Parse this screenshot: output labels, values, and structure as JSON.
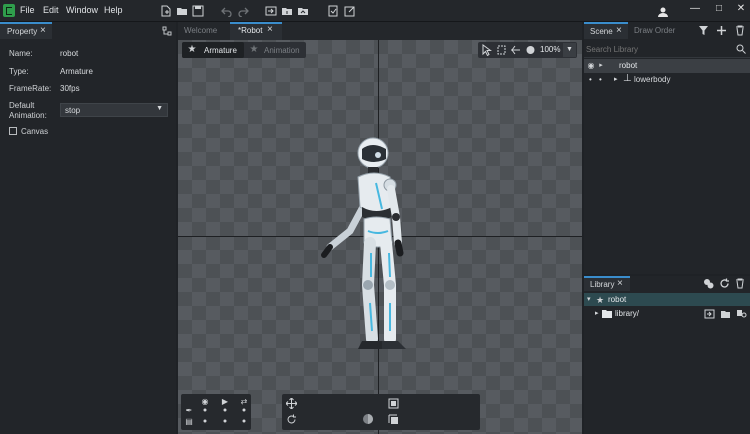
{
  "menu": {
    "items": [
      "File",
      "Edit",
      "Window",
      "Help"
    ]
  },
  "property_panel": {
    "tab_label": "Property",
    "fields": [
      {
        "label": "Name:",
        "value": "robot"
      },
      {
        "label": "Type:",
        "value": "Armature"
      },
      {
        "label": "FrameRate:",
        "value": "30fps"
      }
    ],
    "default_animation_label_1": "Default",
    "default_animation_label_2": "Animation:",
    "default_animation_value": "stop",
    "canvas_label": "Canvas"
  },
  "doc_tabs": [
    {
      "label": "Welcome"
    },
    {
      "label": "*Robot"
    }
  ],
  "mode_tabs": {
    "armature": "Armature",
    "animation": "Animation"
  },
  "zoom": "100%",
  "scene_panel": {
    "tabs": [
      "Scene",
      "Draw Order"
    ],
    "search_placeholder": "Search Library",
    "tree": [
      {
        "label": "robot"
      },
      {
        "label": "lowerbody"
      }
    ]
  },
  "library_panel": {
    "tab_label": "Library",
    "tree": [
      {
        "label": "robot"
      },
      {
        "label": "library/"
      }
    ]
  },
  "colors": {
    "accent": "#3a8dcc",
    "selection": "#2d4a50",
    "brand": "#2f9e4c"
  },
  "icons": [
    "app-logo-icon",
    "new-file-icon",
    "open-folder-icon",
    "save-icon",
    "undo-icon",
    "redo-icon",
    "import-icon",
    "export-icon",
    "folder-export-icon",
    "publish-icon",
    "edit-icon",
    "user-icon",
    "minimize-icon",
    "maximize-icon",
    "close-icon",
    "eye-icon",
    "lock-icon",
    "filter-icon",
    "add-icon",
    "delete-icon",
    "bone-icon",
    "pose-icon",
    "move-icon",
    "rotate-icon"
  ]
}
